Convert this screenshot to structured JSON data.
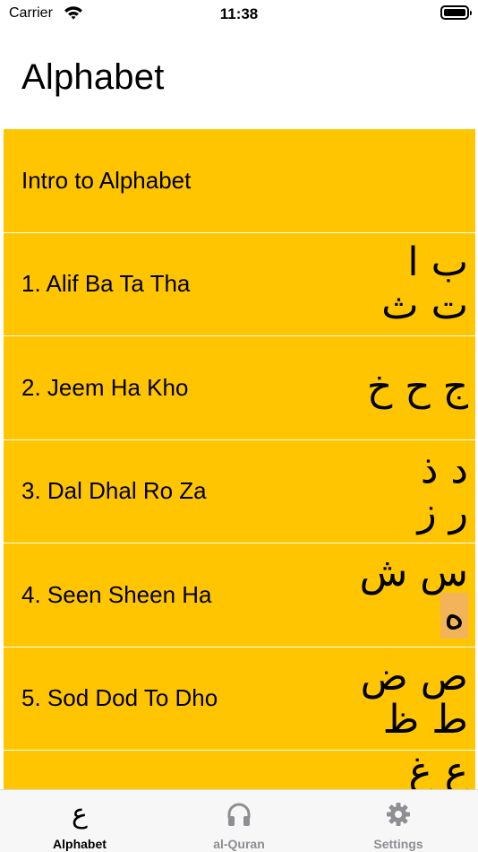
{
  "status_bar": {
    "carrier": "Carrier",
    "time": "11:38"
  },
  "page": {
    "title": "Alphabet"
  },
  "lessons": [
    {
      "label": "Intro to Alphabet",
      "letters": []
    },
    {
      "label": "1. Alif Ba Ta Tha",
      "letters": [
        "ب ا",
        "ت ث"
      ]
    },
    {
      "label": "2. Jeem Ha Kho",
      "letters": [
        "ج ح خ"
      ]
    },
    {
      "label": "3. Dal Dhal Ro Za",
      "letters": [
        "د ذ",
        "ر ز"
      ]
    },
    {
      "label": "4. Seen Sheen Ha",
      "letters": [
        "س ش",
        "ه"
      ]
    },
    {
      "label": "5. Sod Dod To Dho",
      "letters": [
        "ص ض",
        "ط ظ"
      ]
    },
    {
      "label": "",
      "letters": [
        "ع غ"
      ]
    }
  ],
  "tabs": [
    {
      "label": "Alphabet",
      "icon": "ع"
    },
    {
      "label": "al-Quran",
      "icon": "headphones-icon"
    },
    {
      "label": "Settings",
      "icon": "gear-icon"
    }
  ],
  "colors": {
    "row_background": "#ffc500",
    "highlight": "#f2b35a",
    "inactive_tab": "#8e8e93"
  }
}
